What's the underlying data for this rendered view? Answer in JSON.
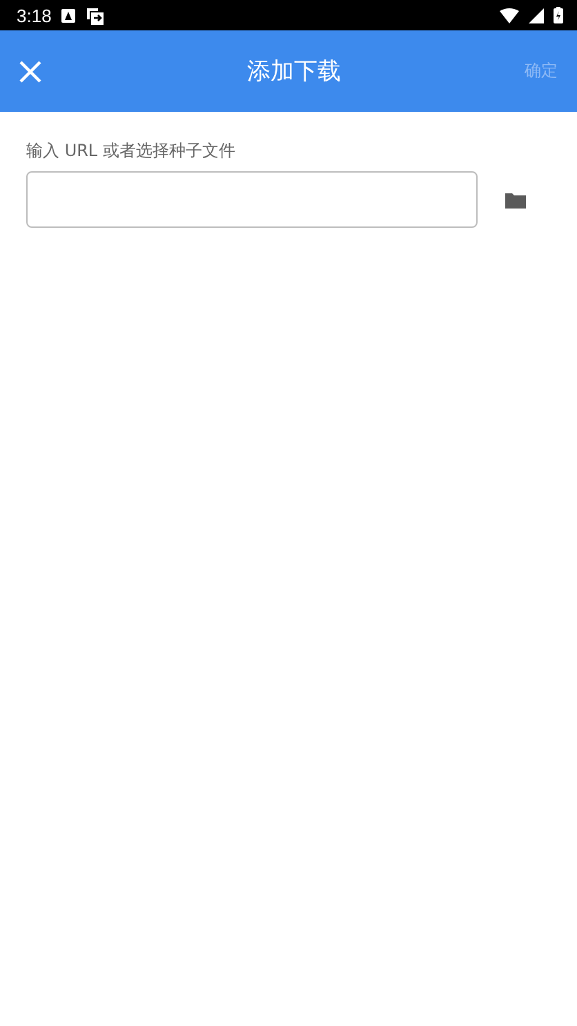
{
  "status_bar": {
    "time": "3:18"
  },
  "toolbar": {
    "title": "添加下载",
    "confirm": {
      "label": "确定",
      "disabled": true
    }
  },
  "url_field": {
    "label": "输入 URL 或者选择种子文件"
  }
}
